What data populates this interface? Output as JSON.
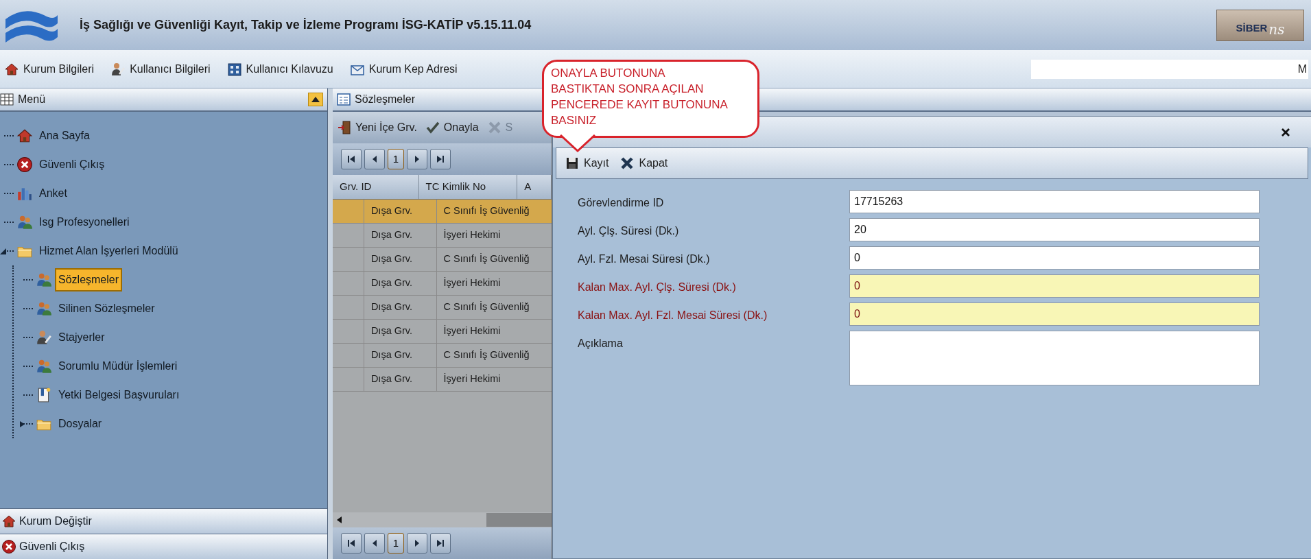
{
  "window": {
    "title": "İş Sağlığı ve Güvenliği Kayıt, Takip ve İzleme Programı İSG-KATİP v5.15.11.04",
    "brand": {
      "name": "SİBER",
      "suffix": "ns"
    }
  },
  "toolbar": {
    "items": [
      {
        "label": "Kurum Bilgileri",
        "kind": "home"
      },
      {
        "label": "Kullanıcı Bilgileri",
        "kind": "user"
      },
      {
        "label": "Kullanıcı Kılavuzu",
        "kind": "book"
      },
      {
        "label": "Kurum Kep Adresi",
        "kind": "mail"
      }
    ],
    "user_field": {
      "value": "M"
    }
  },
  "menu": {
    "title": "Menü",
    "tree": [
      {
        "label": "Ana Sayfa",
        "kind": "home",
        "selected": false
      },
      {
        "label": "Güvenli Çıkış",
        "kind": "exit",
        "selected": false
      },
      {
        "label": "Anket",
        "kind": "chart",
        "selected": false
      },
      {
        "label": "Isg Profesyonelleri",
        "kind": "people",
        "selected": false
      },
      {
        "label": "Hizmet Alan İşyerleri Modülü",
        "kind": "folder",
        "selected": false,
        "expanded": true,
        "children": [
          {
            "label": "Sözleşmeler",
            "kind": "people",
            "selected": true
          },
          {
            "label": "Silinen Sözleşmeler",
            "kind": "people",
            "selected": false
          },
          {
            "label": "Stajyerler",
            "kind": "user",
            "selected": false
          },
          {
            "label": "Sorumlu Müdür İşlemleri",
            "kind": "people",
            "selected": false
          },
          {
            "label": "Yetki Belgesi Başvuruları",
            "kind": "doc",
            "selected": false
          },
          {
            "label": "Dosyalar",
            "kind": "folder",
            "selected": false,
            "expanded": false
          }
        ]
      }
    ],
    "bottom": [
      {
        "label": "Kurum Değiştir",
        "kind": "home"
      },
      {
        "label": "Güvenli Çıkış",
        "kind": "exit"
      }
    ]
  },
  "contracts": {
    "title": "Sözleşmeler",
    "toolbar": [
      {
        "label": "Yeni İçe Grv.",
        "kind": "door",
        "disabled": false
      },
      {
        "label": "Onayla",
        "kind": "check",
        "disabled": false
      },
      {
        "label": "S",
        "kind": "cross",
        "disabled": true
      }
    ],
    "pager_top": {
      "page": "1"
    },
    "pager_bottom": {
      "page": "1"
    },
    "columns": [
      "Grv. ID",
      "TC Kimlik No",
      "A"
    ],
    "rows": [
      {
        "cells": [
          "Dışa Grv.",
          "C Sınıfı İş Güvenliğ"
        ],
        "selected": true
      },
      {
        "cells": [
          "Dışa Grv.",
          "İşyeri Hekimi"
        ],
        "selected": false
      },
      {
        "cells": [
          "Dışa Grv.",
          "C Sınıfı İş Güvenliğ"
        ],
        "selected": false
      },
      {
        "cells": [
          "Dışa Grv.",
          "İşyeri Hekimi"
        ],
        "selected": false
      },
      {
        "cells": [
          "Dışa Grv.",
          "C Sınıfı İş Güvenliğ"
        ],
        "selected": false
      },
      {
        "cells": [
          "Dışa Grv.",
          "İşyeri Hekimi"
        ],
        "selected": false
      },
      {
        "cells": [
          "Dışa Grv.",
          "C Sınıfı İş Güvenliğ"
        ],
        "selected": false
      },
      {
        "cells": [
          "Dışa Grv.",
          "İşyeri Hekimi"
        ],
        "selected": false
      }
    ]
  },
  "dialog": {
    "toolbar": [
      {
        "label": "Kayıt",
        "kind": "save"
      },
      {
        "label": "Kapat",
        "kind": "close"
      }
    ],
    "fields": [
      {
        "label": "Görevlendirme ID",
        "value": "17715263",
        "kind": "text"
      },
      {
        "label": "Ayl. Çlş. Süresi (Dk.)",
        "value": "20",
        "kind": "text"
      },
      {
        "label": "Ayl. Fzl. Mesai Süresi (Dk.)",
        "value": "0",
        "kind": "text"
      },
      {
        "label": "Kalan Max. Ayl. Çlş. Süresi (Dk.)",
        "value": "0",
        "kind": "readonly"
      },
      {
        "label": "Kalan Max. Ayl. Fzl. Mesai Süresi (Dk.)",
        "value": "0",
        "kind": "readonly"
      },
      {
        "label": "Açıklama",
        "kind": "textarea"
      }
    ]
  },
  "callout": {
    "lines": [
      "ONAYLA BUTONUNA",
      "BASTIKTAN SONRA AÇILAN",
      "PENCEREDE KAYIT BUTONUNA",
      "BASINIZ"
    ]
  }
}
